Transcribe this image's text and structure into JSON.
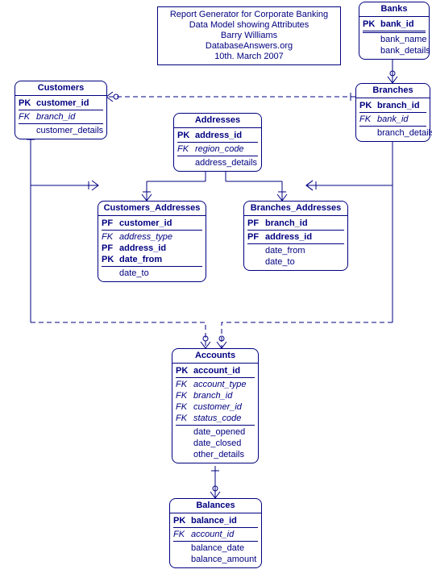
{
  "info": {
    "line1": "Report Generator for Corporate Banking",
    "line2": "Data Model showing Attributes",
    "line3": "Barry Williams",
    "line4": "DatabaseAnswers.org",
    "line5": "10th. March 2007"
  },
  "entities": {
    "banks": {
      "title": "Banks",
      "rows": [
        {
          "key": "PK",
          "name": "bank_id",
          "bold": true
        },
        {
          "key": "",
          "name": "bank_name"
        },
        {
          "key": "",
          "name": "bank_details"
        }
      ]
    },
    "branches": {
      "title": "Branches",
      "rows": [
        {
          "key": "PK",
          "name": "branch_id",
          "bold": true
        },
        {
          "key": "FK",
          "name": "bank_id",
          "italic": true
        },
        {
          "key": "",
          "name": "branch_details"
        }
      ]
    },
    "customers": {
      "title": "Customers",
      "rows": [
        {
          "key": "PK",
          "name": "customer_id",
          "bold": true
        },
        {
          "key": "FK",
          "name": "branch_id",
          "italic": true
        },
        {
          "key": "",
          "name": "customer_details"
        }
      ]
    },
    "addresses": {
      "title": "Addresses",
      "rows": [
        {
          "key": "PK",
          "name": "address_id",
          "bold": true
        },
        {
          "key": "FK",
          "name": "region_code",
          "italic": true
        },
        {
          "key": "",
          "name": "address_details"
        }
      ]
    },
    "customers_addresses": {
      "title": "Customers_Addresses",
      "rows": [
        {
          "key": "PF",
          "name": "customer_id",
          "bold": true
        },
        {
          "key": "FK",
          "name": "address_type",
          "italic": true
        },
        {
          "key": "PF",
          "name": "address_id",
          "bold": true
        },
        {
          "key": "PK",
          "name": "date_from",
          "bold": true
        },
        {
          "key": "",
          "name": "date_to"
        }
      ]
    },
    "branches_addresses": {
      "title": "Branches_Addresses",
      "rows": [
        {
          "key": "PF",
          "name": "branch_id",
          "bold": true
        },
        {
          "key": "PF",
          "name": "address_id",
          "bold": true
        },
        {
          "key": "",
          "name": "date_from"
        },
        {
          "key": "",
          "name": "date_to"
        }
      ]
    },
    "accounts": {
      "title": "Accounts",
      "rows": [
        {
          "key": "PK",
          "name": "account_id",
          "bold": true
        },
        {
          "key": "FK",
          "name": "account_type",
          "italic": true
        },
        {
          "key": "FK",
          "name": "branch_id",
          "italic": true
        },
        {
          "key": "FK",
          "name": "customer_id",
          "italic": true
        },
        {
          "key": "FK",
          "name": "status_code",
          "italic": true
        },
        {
          "key": "",
          "name": "date_opened"
        },
        {
          "key": "",
          "name": "date_closed"
        },
        {
          "key": "",
          "name": "other_details"
        }
      ]
    },
    "balances": {
      "title": "Balances",
      "rows": [
        {
          "key": "PK",
          "name": "balance_id",
          "bold": true
        },
        {
          "key": "FK",
          "name": "account_id",
          "italic": true
        },
        {
          "key": "",
          "name": "balance_date"
        },
        {
          "key": "",
          "name": "balance_amount"
        }
      ]
    }
  }
}
